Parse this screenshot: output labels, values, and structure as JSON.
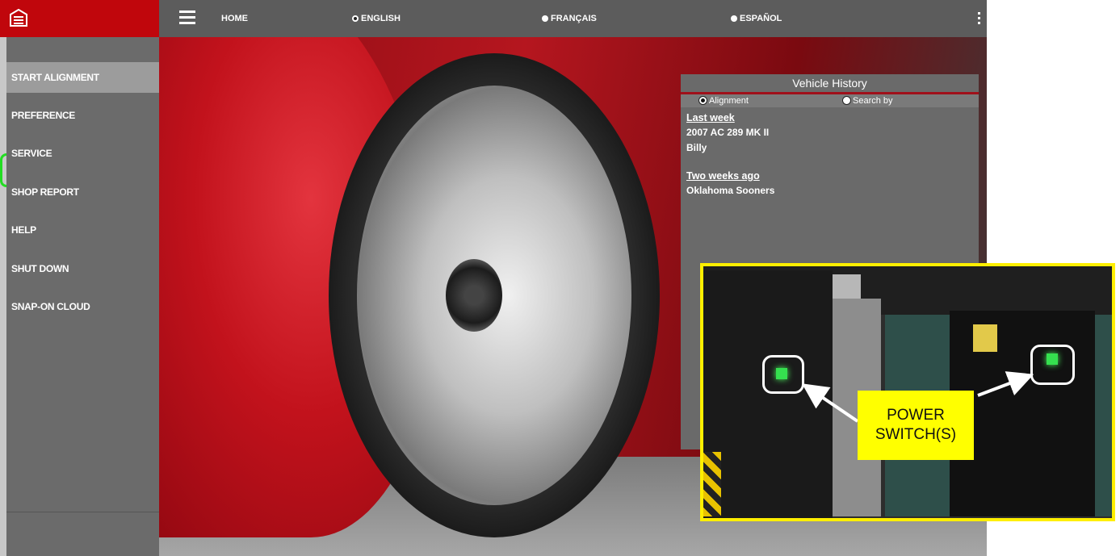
{
  "topbar": {
    "home_label": "HOME",
    "languages": [
      {
        "label": "ENGLISH",
        "selected": true
      },
      {
        "label": "FRANÇAIS",
        "selected": false
      },
      {
        "label": "ESPAÑOL",
        "selected": false
      }
    ]
  },
  "sidebar": {
    "items": [
      {
        "label": "START ALIGNMENT",
        "active": true
      },
      {
        "label": "PREFERENCE",
        "active": false
      },
      {
        "label": "SERVICE",
        "active": false
      },
      {
        "label": "SHOP REPORT",
        "active": false
      },
      {
        "label": "HELP",
        "active": false
      },
      {
        "label": "SHUT DOWN",
        "active": false
      },
      {
        "label": "SNAP-ON CLOUD",
        "active": false
      }
    ]
  },
  "vehicle_history": {
    "title": "Vehicle History",
    "options": [
      {
        "label": "Alignment",
        "selected": true
      },
      {
        "label": "Search by",
        "selected": false
      }
    ],
    "groups": [
      {
        "when": "Last week",
        "lines": [
          "2007 AC 289 MK II",
          "Billy"
        ]
      },
      {
        "when": "Two weeks ago",
        "lines": [
          "Oklahoma Sooners"
        ]
      }
    ]
  },
  "callout": {
    "line1": "POWER",
    "line2": "SWITCH(S)"
  },
  "colors": {
    "brand_red": "#c0060c",
    "sidebar_gray": "#6b6b6b",
    "topbar_gray": "#5c5c5c",
    "highlight_yellow": "#ffef00",
    "switch_green": "#35e04f"
  },
  "icons": {
    "logo": "garage-icon",
    "menu": "hamburger-menu-icon",
    "more": "kebab-menu-icon"
  }
}
